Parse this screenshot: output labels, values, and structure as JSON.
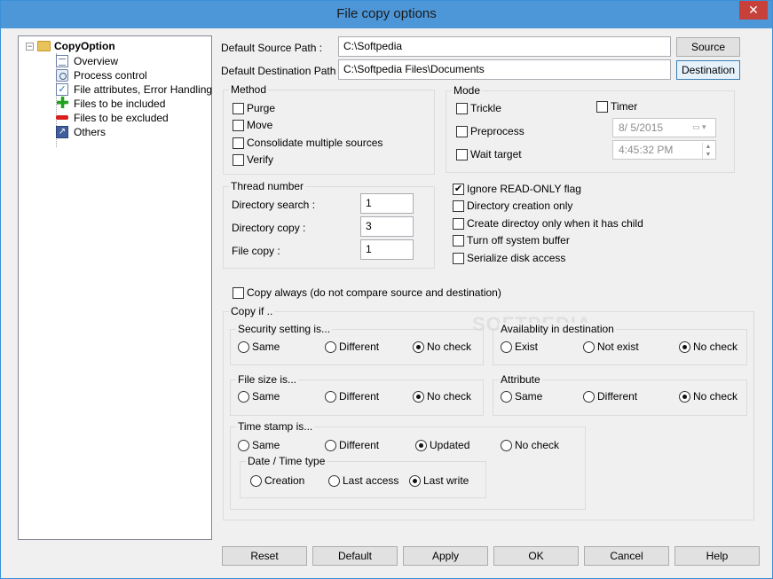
{
  "window": {
    "title": "File copy options",
    "close_glyph": "✕"
  },
  "tree": {
    "root": "CopyOption",
    "items": [
      {
        "label": "Overview",
        "icon": "document-icon"
      },
      {
        "label": "Process control",
        "icon": "gear-icon"
      },
      {
        "label": "File attributes, Error Handling",
        "icon": "checklist-icon"
      },
      {
        "label": "Files to be included",
        "icon": "plus-icon"
      },
      {
        "label": "Files to be excluded",
        "icon": "minus-icon"
      },
      {
        "label": "Others",
        "icon": "shortcut-icon"
      }
    ]
  },
  "paths": {
    "source_label": "Default Source Path :",
    "source_value": "C:\\Softpedia",
    "source_button": "Source",
    "dest_label": "Default Destination Path :",
    "dest_value": "C:\\Softpedia Files\\Documents",
    "dest_button": "Destination"
  },
  "method": {
    "title": "Method",
    "options": [
      {
        "label": "Purge",
        "checked": false
      },
      {
        "label": "Move",
        "checked": false
      },
      {
        "label": "Consolidate multiple sources",
        "checked": false
      },
      {
        "label": "Verify",
        "checked": false
      }
    ]
  },
  "mode": {
    "title": "Mode",
    "trickle": "Trickle",
    "preprocess": "Preprocess",
    "wait_target": "Wait target",
    "timer": "Timer",
    "date": "8/  5/2015",
    "time": "4:45:32 PM"
  },
  "thread": {
    "title": "Thread number",
    "dir_search_label": "Directory search :",
    "dir_search_value": "1",
    "dir_copy_label": "Directory copy :",
    "dir_copy_value": "3",
    "file_copy_label": "File copy :",
    "file_copy_value": "1"
  },
  "flags": [
    {
      "label": "Ignore READ-ONLY flag",
      "checked": true
    },
    {
      "label": "Directory creation only",
      "checked": false
    },
    {
      "label": "Create directoy only when it has child",
      "checked": false
    },
    {
      "label": "Turn off system buffer",
      "checked": false
    },
    {
      "label": "Serialize disk access",
      "checked": false
    }
  ],
  "copy_always": "Copy always (do not compare source and destination)",
  "copy_if": {
    "title": "Copy if ..",
    "security": {
      "title": "Security setting is...",
      "opt1": "Same",
      "opt2": "Different",
      "opt3": "No check"
    },
    "availability": {
      "title": "Availablity in destination",
      "opt1": "Exist",
      "opt2": "Not exist",
      "opt3": "No check"
    },
    "filesize": {
      "title": "File size is...",
      "opt1": "Same",
      "opt2": "Different",
      "opt3": "No check"
    },
    "attribute": {
      "title": "Attribute",
      "opt1": "Same",
      "opt2": "Different",
      "opt3": "No check"
    },
    "timestamp": {
      "title": "Time stamp is...",
      "opt1": "Same",
      "opt2": "Different",
      "opt3": "Updated",
      "opt4": "No check"
    },
    "datetime_type": {
      "title": "Date / Time type",
      "opt1": "Creation",
      "opt2": "Last access",
      "opt3": "Last write"
    }
  },
  "buttons": {
    "reset": "Reset",
    "default": "Default",
    "apply": "Apply",
    "ok": "OK",
    "cancel": "Cancel",
    "help": "Help"
  },
  "watermark": "SOFTPEDIA",
  "colors": {
    "titlebar": "#4d97d9",
    "close": "#c7403a",
    "face": "#f0f0f0"
  }
}
